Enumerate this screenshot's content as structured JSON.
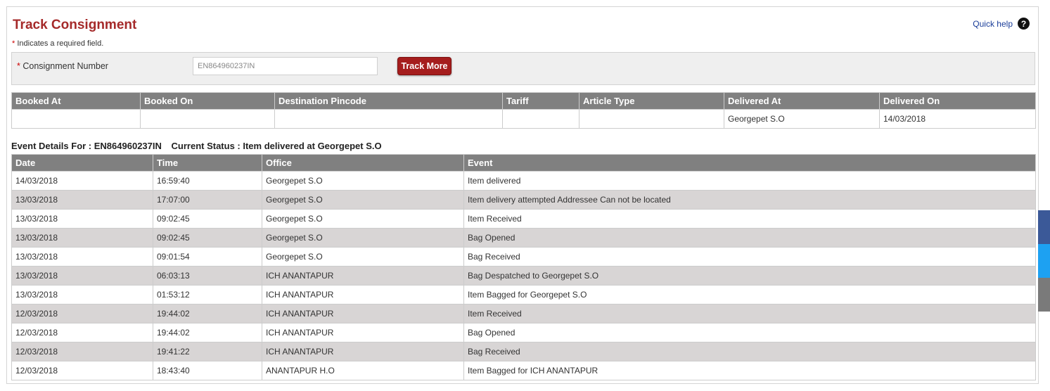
{
  "page": {
    "title": "Track Consignment",
    "quick_help": "Quick help",
    "help_glyph": "?"
  },
  "form": {
    "required_note": "Indicates a required field.",
    "required_marker": "*",
    "consignment_label": "Consignment Number",
    "consignment_value": "EN864960237IN",
    "track_button": "Track More"
  },
  "booking": {
    "headers": [
      "Booked At",
      "Booked On",
      "Destination Pincode",
      "Tariff",
      "Article Type",
      "Delivered At",
      "Delivered On"
    ],
    "row": [
      "",
      "",
      "",
      "",
      "",
      "Georgepet S.O",
      "14/03/2018"
    ]
  },
  "events": {
    "details_for": "Event Details For : EN864960237IN",
    "current_status": "Current Status : Item delivered at Georgepet S.O",
    "headers": [
      "Date",
      "Time",
      "Office",
      "Event"
    ],
    "rows": [
      [
        "14/03/2018",
        "16:59:40",
        "Georgepet S.O",
        "Item delivered"
      ],
      [
        "13/03/2018",
        "17:07:00",
        "Georgepet S.O",
        "Item delivery attempted Addressee Can not be located"
      ],
      [
        "13/03/2018",
        "09:02:45",
        "Georgepet S.O",
        "Item Received"
      ],
      [
        "13/03/2018",
        "09:02:45",
        "Georgepet S.O",
        "Bag Opened"
      ],
      [
        "13/03/2018",
        "09:01:54",
        "Georgepet S.O",
        "Bag Received"
      ],
      [
        "13/03/2018",
        "06:03:13",
        "ICH ANANTAPUR",
        "Bag Despatched to Georgepet S.O"
      ],
      [
        "13/03/2018",
        "01:53:12",
        "ICH ANANTAPUR",
        "Item Bagged for Georgepet S.O"
      ],
      [
        "12/03/2018",
        "19:44:02",
        "ICH ANANTAPUR",
        "Item Received"
      ],
      [
        "12/03/2018",
        "19:44:02",
        "ICH ANANTAPUR",
        "Bag Opened"
      ],
      [
        "12/03/2018",
        "19:41:22",
        "ICH ANANTAPUR",
        "Bag Received"
      ],
      [
        "12/03/2018",
        "18:43:40",
        "ANANTAPUR H.O",
        "Item Bagged for ICH ANANTAPUR"
      ]
    ]
  },
  "social": [
    {
      "icon": "facebook-icon",
      "color": "#3b5998"
    },
    {
      "icon": "twitter-icon",
      "color": "#1da1f2"
    },
    {
      "icon": "share-icon",
      "color": "#7a7a7a"
    }
  ],
  "colors": {
    "title": "#a52a2a",
    "header_bg": "#808080",
    "alt_row": "#d8d5d5",
    "button_bg": "#a51d1d"
  }
}
